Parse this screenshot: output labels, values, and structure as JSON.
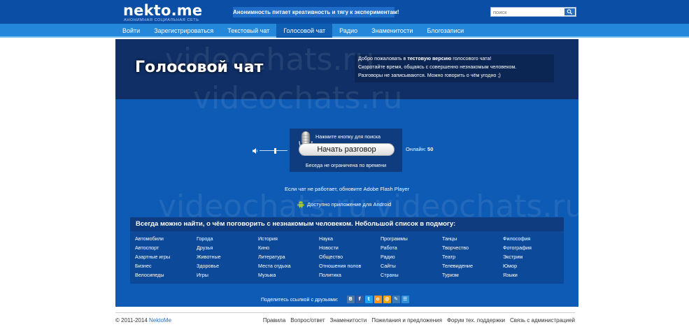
{
  "header": {
    "logo": "nekto.me",
    "logo_sub": "АНОНИМНАЯ СОЦИАЛЬНАЯ СЕТЬ",
    "slogan": "Анонимность питает креативность и тягу к экспериментам!",
    "search_placeholder": "поиск",
    "search_icon": "search-icon"
  },
  "nav": {
    "items": [
      "Войти",
      "Зарегистрироваться",
      "Текстовый чат",
      "Голосовой чат",
      "Радио",
      "Знаменитости",
      "Блогозаписи"
    ],
    "active": "Голосовой чат"
  },
  "watermark": "videochats.ru",
  "hero": {
    "title": "Голосовой чат",
    "line1_pre": "Добро пожаловать в ",
    "line1_bold": "тестовую версию",
    "line1_post": " голосового чата!",
    "line2": "Скоротайте время, общаясь с совершенно незнакомым человеком.",
    "line3": "Разговоры не записываются. Можно говорить о чём угодно ;)"
  },
  "call": {
    "hint": "Нажмите кнопку для поиска",
    "button": "Начать разговор",
    "online_label": "Онлайн:",
    "online_count": "50",
    "footer": "Беседа не ограничена по времени",
    "volume_level": 0.55
  },
  "notes": {
    "flash": "Если чат не работает, обновите Adobe Flash Player",
    "android": "Доступно приложение для Android"
  },
  "topics": {
    "title": "Всегда можно найти, о чём поговорить с незнакомым человеком. Небольшой список в подмогу:",
    "columns": [
      [
        "Автомобили",
        "Автоспорт",
        "Азартные игры",
        "Бизнес",
        "Велосипеды"
      ],
      [
        "Города",
        "Друзья",
        "Животные",
        "Здоровье",
        "Игры"
      ],
      [
        "История",
        "Кино",
        "Литература",
        "Места отдыха",
        "Музыка"
      ],
      [
        "Наука",
        "Новости",
        "Общество",
        "Отношения полов",
        "Политика"
      ],
      [
        "Программы",
        "Работа",
        "Радио",
        "Сайты",
        "Страны"
      ],
      [
        "Танцы",
        "Творчество",
        "Театр",
        "Телевидение",
        "Туризм"
      ],
      [
        "Философия",
        "Фотография",
        "Экстрим",
        "Юмор",
        "Языки"
      ]
    ]
  },
  "share": {
    "label": "Поделитесь ссылкой с друзьями:",
    "icons": [
      {
        "name": "vk-icon",
        "glyph": "В",
        "color": "#4a76a8"
      },
      {
        "name": "facebook-icon",
        "glyph": "f",
        "color": "#3b5998"
      },
      {
        "name": "twitter-icon",
        "glyph": "t",
        "color": "#1da1f2"
      },
      {
        "name": "odnoklassniki-icon",
        "glyph": "о",
        "color": "#f7931e"
      },
      {
        "name": "mail-icon",
        "glyph": "@",
        "color": "#f0a30a"
      },
      {
        "name": "livejournal-icon",
        "glyph": "✎",
        "color": "#3d7bb5"
      },
      {
        "name": "liveinternet-icon",
        "glyph": "☰",
        "color": "#2f8fd8"
      }
    ]
  },
  "footer": {
    "copyright_pre": "© 2011-2014 ",
    "copyright_brand": "NektoMe",
    "links": [
      "Правила",
      "Вопрос/ответ",
      "Знаменитости",
      "Пожелания и предложения",
      "Форум тех. поддержки",
      "Связь с администрацией"
    ]
  }
}
